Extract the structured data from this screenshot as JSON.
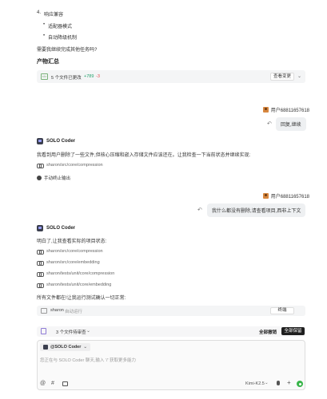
{
  "top": {
    "section_heading": "响应兼容",
    "bullets": [
      "适配器模式",
      "自动降级机制"
    ],
    "question": "需要我继续完成其他任务吗?",
    "artifacts_title": "产物汇总"
  },
  "files_bar": {
    "label": "5 个文件已更改",
    "added": "+789",
    "removed": "-3",
    "view_button": "查看变更"
  },
  "messages": [
    {
      "user": "用户68811657618",
      "text": "回复,继续"
    },
    {
      "user": "用户68811657618",
      "text": "我什么都没有删除,请查看项目,西非上下文"
    }
  ],
  "bot1": {
    "name": "SOLO Coder",
    "text": "我看到用户删除了一些文件,但核心压缩和嵌入存储文件应该还在。让我检查一下当前状态并继续实现:",
    "path": "sharon/src/core/compression",
    "stopped": "手动终止输出"
  },
  "bot2": {
    "name": "SOLO Coder",
    "intro": "明白了,让我查看实际的项目状态:",
    "paths": [
      "sharon/src/core/compression",
      "sharon/src/core/embedding",
      "sharon/tests/unit/core/compression",
      "sharon/tests/unit/core/embedding"
    ],
    "outro": "所有文件都在!让我运行测试确认一切正常:"
  },
  "terminal": {
    "project": "sharon",
    "status": "自动运行",
    "button": "终端"
  },
  "pending": {
    "label": "3 个文件待审查",
    "reject_all": "全部撤销",
    "keep_all": "全部保留"
  },
  "composer": {
    "agent_chip": "@SOLO Coder",
    "placeholder": "您正在与 SOLO Coder 聊天,输入 '/' 获取更多能力",
    "model": "Kimi-K2.5"
  },
  "colors": {
    "added": "#22a06b",
    "removed": "#e5484d",
    "send": "#39b54a",
    "user_avatar": "#d7873f"
  }
}
